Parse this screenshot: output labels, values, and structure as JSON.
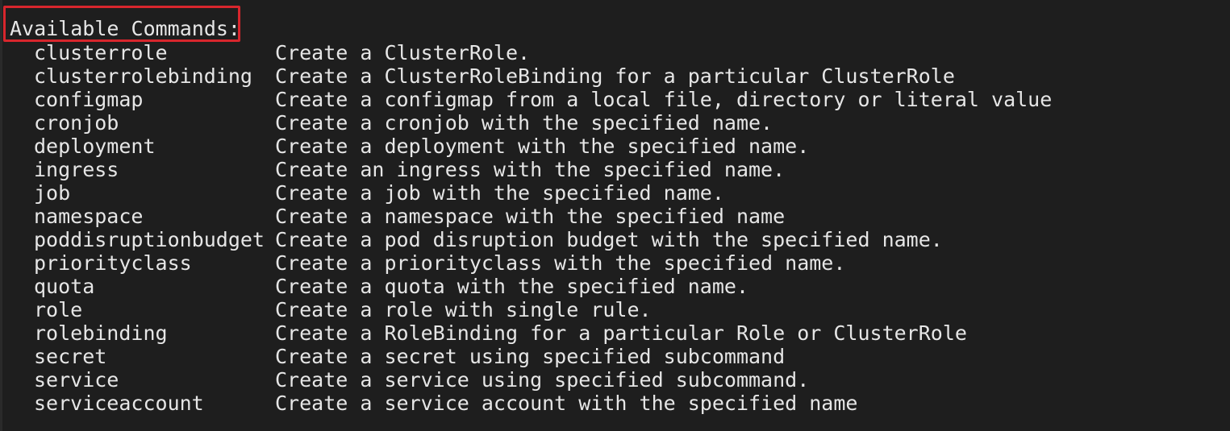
{
  "terminal": {
    "header": "Available Commands:",
    "highlight_color": "#d8262d",
    "background_color": "#1e1e1e",
    "text_color": "#e6e6e6",
    "commands": [
      {
        "name": "clusterrole",
        "description": "Create a ClusterRole."
      },
      {
        "name": "clusterrolebinding",
        "description": "Create a ClusterRoleBinding for a particular ClusterRole"
      },
      {
        "name": "configmap",
        "description": "Create a configmap from a local file, directory or literal value"
      },
      {
        "name": "cronjob",
        "description": "Create a cronjob with the specified name."
      },
      {
        "name": "deployment",
        "description": "Create a deployment with the specified name."
      },
      {
        "name": "ingress",
        "description": "Create an ingress with the specified name."
      },
      {
        "name": "job",
        "description": "Create a job with the specified name."
      },
      {
        "name": "namespace",
        "description": "Create a namespace with the specified name"
      },
      {
        "name": "poddisruptionbudget",
        "description": "Create a pod disruption budget with the specified name."
      },
      {
        "name": "priorityclass",
        "description": "Create a priorityclass with the specified name."
      },
      {
        "name": "quota",
        "description": "Create a quota with the specified name."
      },
      {
        "name": "role",
        "description": "Create a role with single rule."
      },
      {
        "name": "rolebinding",
        "description": "Create a RoleBinding for a particular Role or ClusterRole"
      },
      {
        "name": "secret",
        "description": "Create a secret using specified subcommand"
      },
      {
        "name": "service",
        "description": "Create a service using specified subcommand."
      },
      {
        "name": "serviceaccount",
        "description": "Create a service account with the specified name"
      }
    ]
  }
}
